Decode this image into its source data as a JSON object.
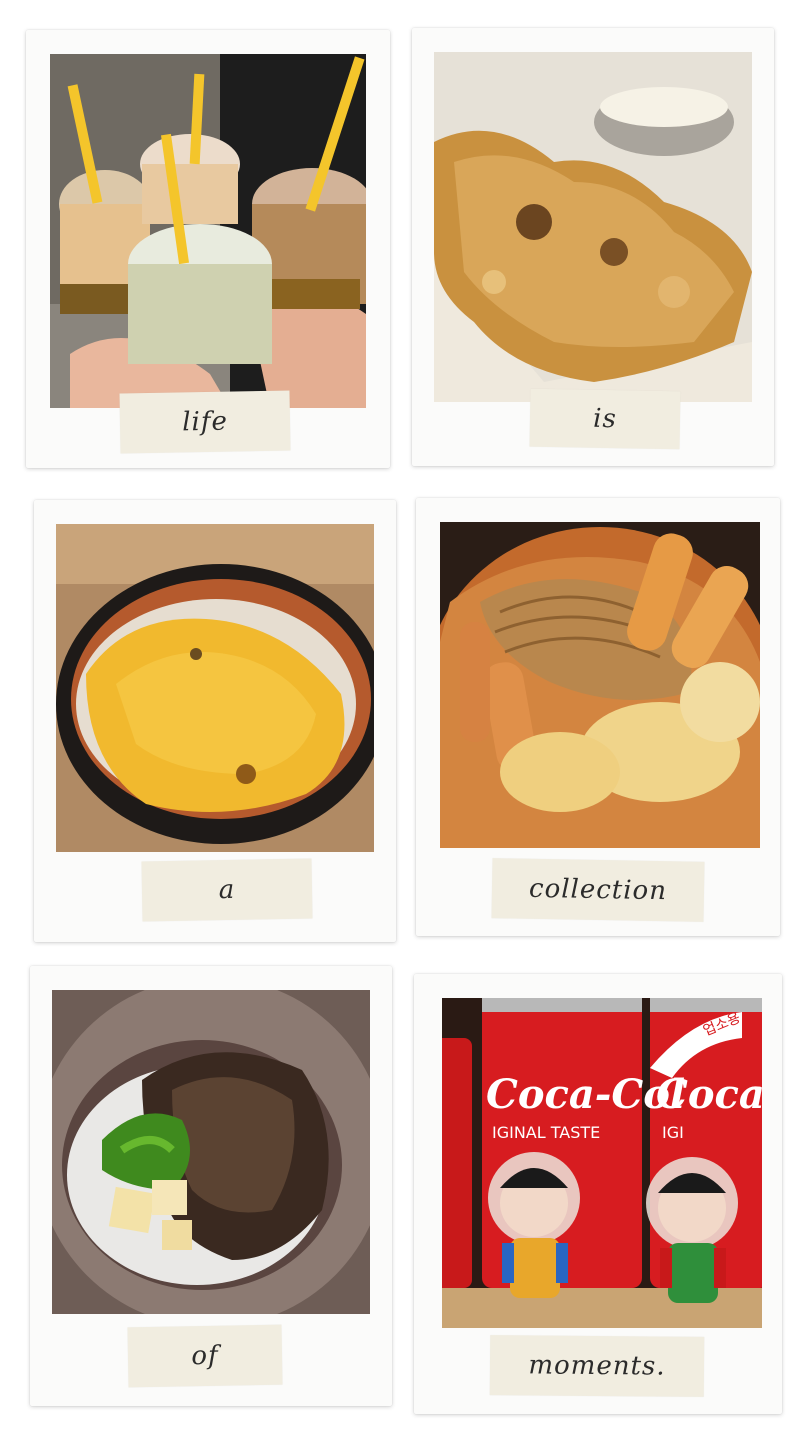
{
  "captions": [
    "life",
    "is",
    "a",
    "collection",
    "of",
    "moments."
  ],
  "photos": [
    {
      "subject": "four iced drinks with yellow straws held up for a toast"
    },
    {
      "subject": "fried crispy chicken in paper-lined basket with dipping sauce"
    },
    {
      "subject": "cheese-topped dish in black stone bowl"
    },
    {
      "subject": "rabokki with ramen noodles, rice cakes and melted cheese"
    },
    {
      "subject": "bibimbap-style rice with bulgogi, green pepper and radish"
    },
    {
      "subject": "Coca-Cola cans with two astronaut figurines"
    }
  ],
  "cans": {
    "brand_left": "Coca-Col",
    "brand_right": "Coca",
    "sub_left": "IGINAL TASTE",
    "sub_right": "IGI",
    "korean_badge": "업소용"
  }
}
